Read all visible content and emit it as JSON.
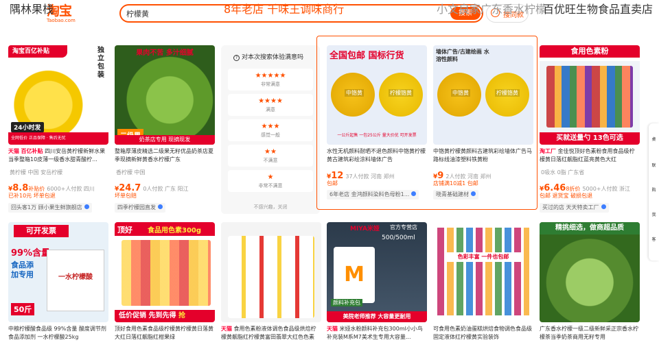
{
  "header": {
    "logo_cn": "淘宝",
    "logo_en": "Taobao.com",
    "search_query": "柠檬黄",
    "search_button": "搜索",
    "photo_search": "搜同款"
  },
  "shoplines": [
    "隅林果栈",
    "8年老店  千味王调味商行",
    "小文良家广东香水柠檬",
    "百优旺生物食品直卖店"
  ],
  "survey": {
    "question": "对本次搜索体验满意吗",
    "options": [
      {
        "stars": "★★★★★",
        "label": "非常满意"
      },
      {
        "stars": "★★★★",
        "label": "满意"
      },
      {
        "stars": "★★★",
        "label": "感觉一般"
      },
      {
        "stars": "★★",
        "label": "不满意"
      },
      {
        "stars": "★",
        "label": "非常不满意"
      }
    ],
    "close_text": "不感兴趣，关闭"
  },
  "row1": [
    {
      "ribbon": "淘宝百亿补贴",
      "side_text": "独立包装",
      "badge_text": "24小时发",
      "corner": "全网低价",
      "corner2": "正品保障 · 售后无忧",
      "title_tag": "天猫",
      "title_tag2": "百亿补贴",
      "title": "四川安岳黄柠檬新鲜水果当季整箱10皮薄一级香水甜青酸柠...",
      "meta": "黄柠檬    中国    安岳柠檬",
      "price_yen": "¥",
      "price": "8.8",
      "price_sub": "补贴价",
      "sales": "6000+人付款  四川",
      "badge": "已补10元   坏单包退",
      "shop": "回头客1万  顾小果生鲜旗舰店"
    },
    {
      "ribbon": "果肉不苦 多汁细腻",
      "badge_text": "二级果",
      "strip": "奶茶店专用 现摘现发",
      "title": "整箱厚薄皮精选二级果无籽优品奶茶店夏季现摘新鲜黄香水柠檬广东",
      "meta": "香柠檬    中国",
      "price_yen": "¥",
      "price": "24.7",
      "price_sub": "",
      "sales": "0人付款  广东 阳江",
      "badge": "坏单包赔",
      "shop": "四季柠檬园直发"
    },
    {
      "ribbon": "全国包邮 国标行货",
      "labels": [
        "中铬黄",
        "柠檬铬黄"
      ],
      "bottom": "一公斤起售 一包25公斤 量大价优 可开发票",
      "title": "水性无机颜料耐晒不退色颜料中铬黄柠檬黄古建筑彩绘涂料墙体广告",
      "price_yen": "¥",
      "price": "12",
      "sales": "37人付款  河南 郑州",
      "badge": "包邮",
      "shop": "6年老店  金鸿颜料染料色母粉1..."
    },
    {
      "ribbon": "墙体广告/古建绘画 水溶性颜料",
      "labels": [
        "中铬黄",
        "柠檬铬黄"
      ],
      "title": "中铬黄柠檬黄颜料古建筑彩绘墙体广告马路标线油漆塑料铁黄粉",
      "price_yen": "¥",
      "price": "9",
      "sales": "2人付款  河南 郑州",
      "badge": "店铺满10减1   包邮",
      "shop": "晓青基础建材"
    },
    {
      "ribbon": "食用色素粉",
      "strip": "买就送量勺 13色可选",
      "title_tag": "淘工厂",
      "title": "金佳悦顶好色素粉食用食品级柠檬黄日落红靓脂红蓝亮黄色大红",
      "meta": "0吸水    0脂    广东省",
      "price_yen": "¥",
      "price": "6.46",
      "price_sub": "8折价",
      "sales": "5000+人付款  浙江",
      "badge": "包邮   退货宝   破损包退",
      "shop": "买过的店  天天特卖工厂"
    }
  ],
  "row2": [
    {
      "ribbon": "可开发票",
      "big": "99%含量",
      "big2": "食品添加专用",
      "bag": "一水柠檬酸",
      "price_tag": "50斤",
      "title": "中粮柠檬酸食品级 99%含量 酸度调节剂食品添加剂 一水柠檬酸25kg"
    },
    {
      "ribbon": "顶好",
      "ribbon2": "食品用色素300g",
      "bottom": "低价促销 先到先得",
      "bottom2": "抢",
      "title": "顶好食用色素食品级柠檬黄柠檬黄日落黄大红日落红靓脂红柑果绿"
    },
    {
      "title_tag": "天猫",
      "title": "食用色素粉液体调色食品级烘焙柠檬黄靓脂红柠檬黄富田翡翠大红色色素"
    },
    {
      "ribbon": "MIYA米娅",
      "ribbon2": "官方专营店",
      "volume": "500/500ml",
      "letter": "M",
      "strip": "颜料补充包",
      "bottom": "美院老师推荐 大容量更耐用",
      "title_tag": "天猫",
      "title": "米娅水粉颜料补充包300ml小小鸟补充装M系M7美术生专用大容量..."
    },
    {
      "strip": "色彩丰富 一件也包邮",
      "title": "可食用色素奶油蛋糕烘焙食物调色食品级固定液体红柠檬黄实验装饰"
    },
    {
      "ribbon": "精挑细选，做商超品质",
      "title": "广东香水柠檬一级二级新鲜采正宗香水柠檬茶当季奶茶商用无籽专用"
    }
  ],
  "sidebar": [
    "桌",
    "联",
    "购",
    "我",
    "客"
  ]
}
